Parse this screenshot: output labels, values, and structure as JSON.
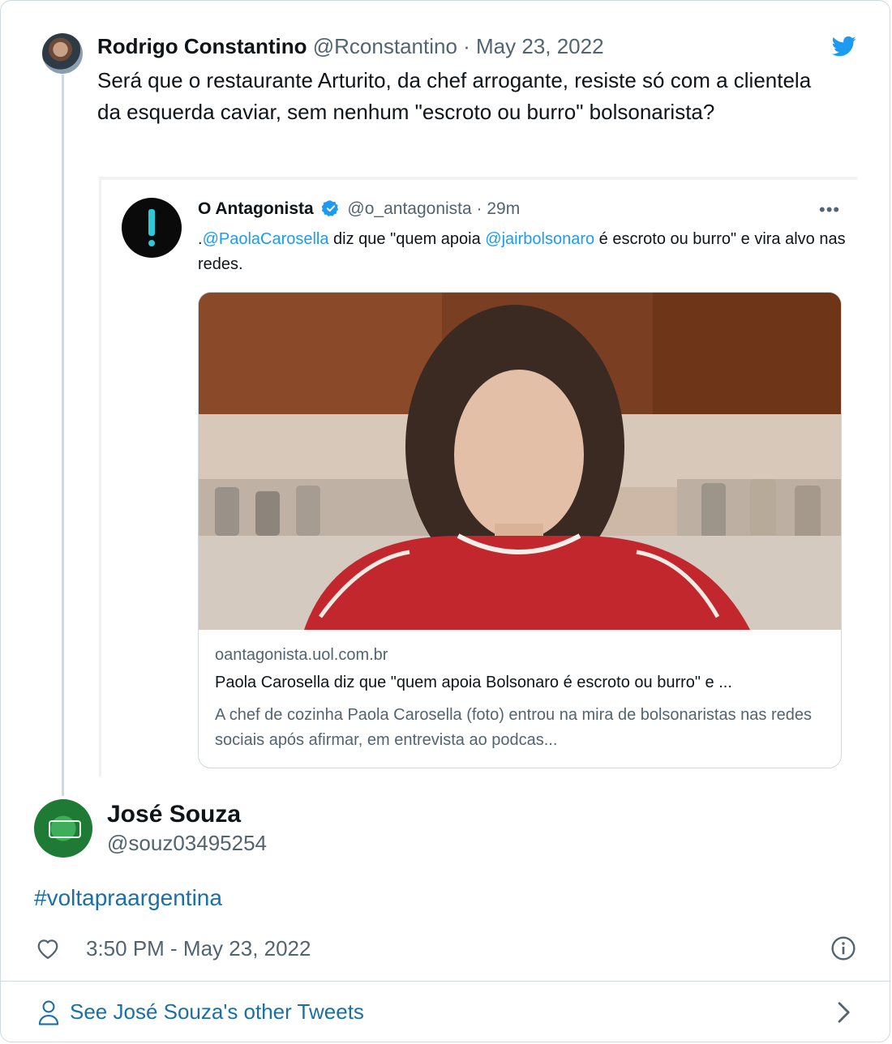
{
  "top_tweet": {
    "name": "Rodrigo Constantino",
    "handle": "@Rconstantino",
    "separator": " · ",
    "date": "May 23, 2022",
    "text": "Será que o restaurante Arturito, da chef arrogante, resiste só com a clientela da esquerda caviar, sem nenhum \"escroto ou burro\" bolsonarista?"
  },
  "embedded_tweet": {
    "name": "O Antagonista",
    "handle": "@o_antagonista",
    "time": "· 29m",
    "more": "•••",
    "text_prefix": ".",
    "mention_1": "@PaolaCarosella",
    "text_mid": " diz que \"quem apoia ",
    "mention_2": "@jairbolsonaro",
    "text_end": " é escroto ou burro\" e vira alvo nas redes.",
    "link_card": {
      "domain": "oantagonista.uol.com.br",
      "title": "Paola Carosella diz que \"quem apoia Bolsonaro é escroto ou burro\" e ...",
      "description": "A chef de cozinha Paola Carosella (foto) entrou na mira de bolsonaristas nas redes sociais após afirmar, em entrevista ao podcas..."
    }
  },
  "bottom_tweet": {
    "name": "José Souza",
    "handle": "@souz03495254",
    "hashtag": "#voltapraargentina",
    "timestamp": "3:50 PM - May 23, 2022"
  },
  "footer": {
    "see_more": "See José Souza's other Tweets"
  },
  "colors": {
    "twitter_blue": "#1d9bf0",
    "link_blue": "#1b6fa8",
    "secondary_text": "#536471",
    "border": "#cfd9de"
  },
  "icons": [
    "twitter-bird-icon",
    "verified-badge-icon",
    "more-icon",
    "heart-icon",
    "info-icon",
    "person-icon",
    "chevron-right-icon"
  ]
}
